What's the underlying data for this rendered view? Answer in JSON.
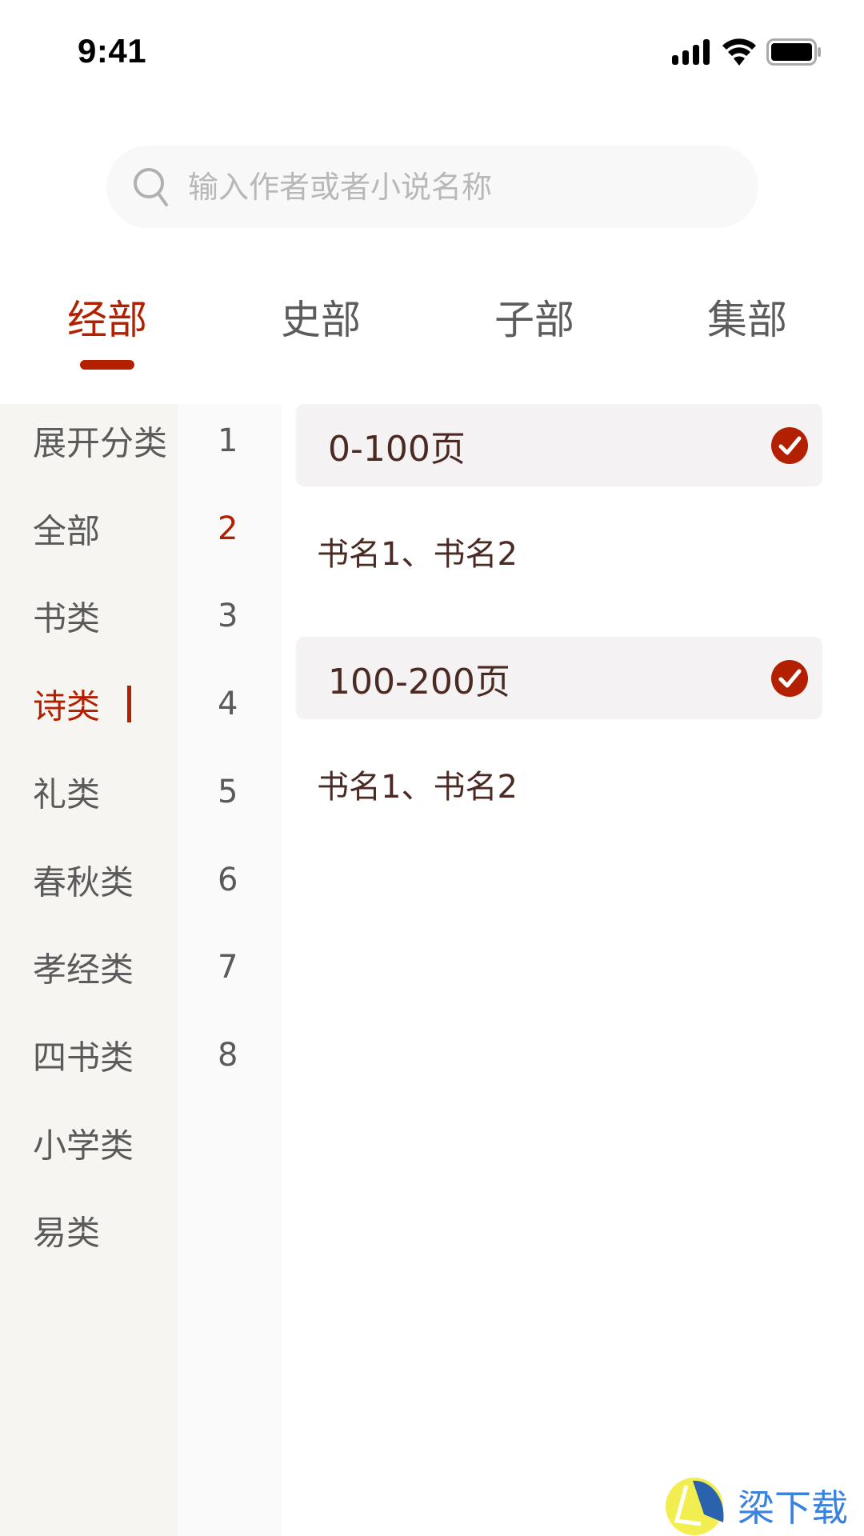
{
  "status_bar": {
    "time": "9:41",
    "icons": [
      "signal-icon",
      "wifi-icon",
      "battery-icon"
    ]
  },
  "search": {
    "placeholder": "输入作者或者小说名称",
    "value": "",
    "icon": "search-icon"
  },
  "tabs": [
    {
      "label": "经部",
      "active": true
    },
    {
      "label": "史部",
      "active": false
    },
    {
      "label": "子部",
      "active": false
    },
    {
      "label": "集部",
      "active": false
    }
  ],
  "sidebar": {
    "items": [
      {
        "label": "展开分类",
        "count": "1",
        "active": false,
        "count_highlight": false
      },
      {
        "label": "全部",
        "count": "2",
        "active": false,
        "count_highlight": true
      },
      {
        "label": "书类",
        "count": "3",
        "active": false,
        "count_highlight": false
      },
      {
        "label": "诗类",
        "count": "4",
        "active": true,
        "count_highlight": false
      },
      {
        "label": "礼类",
        "count": "5",
        "active": false,
        "count_highlight": false
      },
      {
        "label": "春秋类",
        "count": "6",
        "active": false,
        "count_highlight": false
      },
      {
        "label": "孝经类",
        "count": "7",
        "active": false,
        "count_highlight": false
      },
      {
        "label": "四书类",
        "count": "8",
        "active": false,
        "count_highlight": false
      },
      {
        "label": "小学类",
        "count": "",
        "active": false,
        "count_highlight": false
      },
      {
        "label": "易类",
        "count": "",
        "active": false,
        "count_highlight": false
      }
    ]
  },
  "content": {
    "groups": [
      {
        "title": "0-100页",
        "checked": true,
        "books": "书名1、书名2"
      },
      {
        "title": "100-200页",
        "checked": true,
        "books": "书名1、书名2"
      }
    ]
  },
  "watermark": {
    "text": "梁下载",
    "icon": "logo-icon"
  },
  "colors": {
    "accent": "#b32000",
    "text_primary": "#4a2a22",
    "text_secondary": "#5a5a5a",
    "placeholder": "#b8b8b8",
    "card_bg": "#f4f2f2",
    "sidebar_bg": "#f6f5f2"
  }
}
